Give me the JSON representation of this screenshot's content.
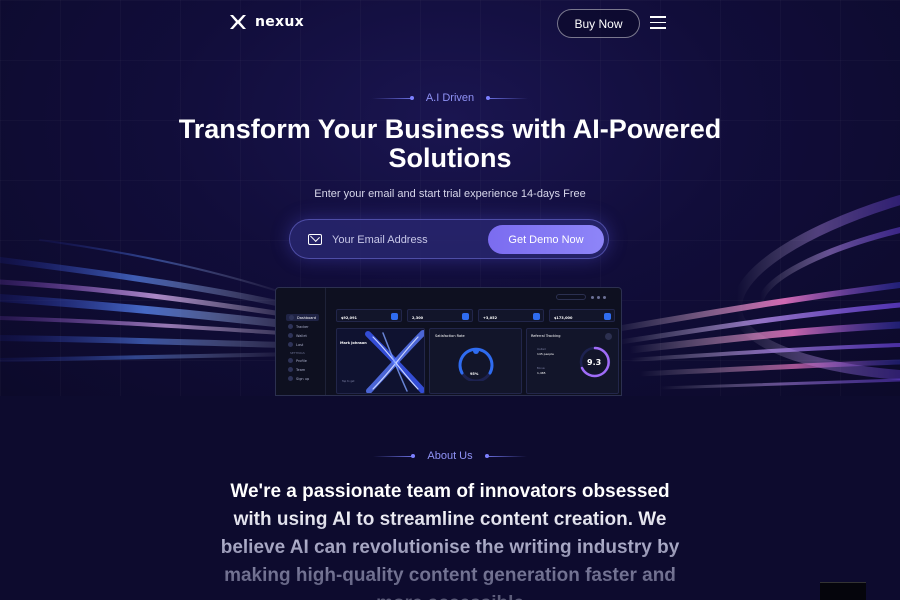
{
  "nav": {
    "logo_text": "nexux",
    "buy_button": "Buy Now",
    "menu_icon": "hamburger-menu-icon"
  },
  "hero": {
    "tagline": "A.I Driven",
    "title": "Transform Your Business with AI-Powered Solutions",
    "subtitle": "Enter your email and start trial experience 14-days Free",
    "email_placeholder": "Your Email Address",
    "cta_button": "Get Demo Now",
    "mail_icon": "mail-icon"
  },
  "dashboard": {
    "sidebar_title": "",
    "sidebar_items": [
      "Dashboard",
      "Tracker",
      "Wallet",
      "Last"
    ],
    "sidebar_section": "SETTINGS",
    "sidebar_items_2": [
      "Profile",
      "Team",
      "Sign up"
    ],
    "header_title": "",
    "header_sub": "",
    "search_placeholder": "",
    "stats": [
      {
        "label": "",
        "value": "$92,091"
      },
      {
        "label": "",
        "value": "2,300"
      },
      {
        "label": "",
        "value": "+3,052"
      },
      {
        "label": "",
        "value": "$173,000"
      }
    ],
    "profile_card": {
      "name": "Mark Johnson",
      "footer": "Tap to get"
    },
    "satisfaction_card": {
      "title": "Satisfaction Rate",
      "value": "95%"
    },
    "referral_card": {
      "title": "Referral Tracking",
      "label_1": "Invited",
      "value_1": "145 people",
      "label_2": "Bonus",
      "value_2": "1,465",
      "score": "9.3"
    }
  },
  "about": {
    "tagline": "About Us",
    "text": "We're a passionate team of innovators obsessed with using AI to streamline content creation. We believe AI can revolutionise the writing industry by making high-quality content generation faster and more accessible"
  },
  "colors": {
    "background": "#0d0b2e",
    "accent": "#8e85f8",
    "tagline": "#8f92f5"
  }
}
